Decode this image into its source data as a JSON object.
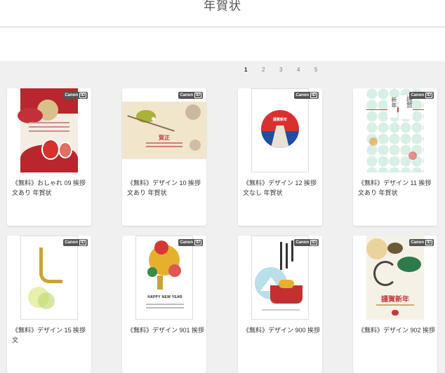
{
  "page": {
    "title": "年賀状"
  },
  "pagination": {
    "pages": [
      "1",
      "2",
      "3",
      "4",
      "5"
    ],
    "current": "1"
  },
  "cards": [
    {
      "caption": "《無料》おしゃれ 09 挨拶文あり 年賀状",
      "badge_brand": "Canon",
      "badge_id": "ID"
    },
    {
      "caption": "《無料》デザイン 10 挨拶文あり 年賀状",
      "badge_brand": "Canon",
      "badge_id": "ID",
      "art_text": "賀正"
    },
    {
      "caption": "《無料》デザイン 12 挨拶文なし 年賀状",
      "badge_brand": "Canon",
      "badge_id": "ID",
      "art_text": "謹賀新年"
    },
    {
      "caption": "《無料》デザイン 11 挨拶文あり 年賀状",
      "badge_brand": "Canon",
      "badge_id": "ID",
      "art_text_1": "謹賀",
      "art_text_2": "新年"
    },
    {
      "caption": "《無料》デザイン 15 挨拶文",
      "badge_brand": "Canon",
      "badge_id": "ID"
    },
    {
      "caption": "《無料》デザイン 901 挨拶",
      "badge_brand": "Canon",
      "badge_id": "ID",
      "art_text": "HAPPY NEW YEAR"
    },
    {
      "caption": "《無料》デザイン 900 挨拶",
      "badge_brand": "Canon",
      "badge_id": "ID"
    },
    {
      "caption": "《無料》デザイン 902 挨拶",
      "badge_brand": "Canon",
      "badge_id": "ID",
      "art_text": "謹賀新年"
    }
  ]
}
